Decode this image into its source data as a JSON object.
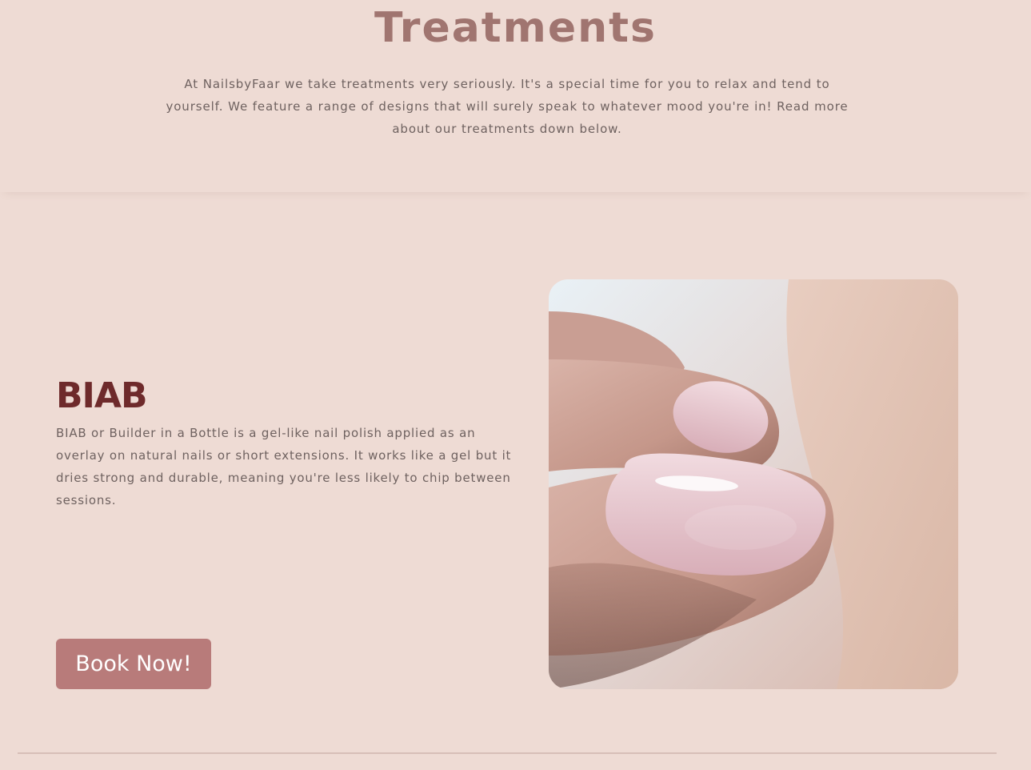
{
  "hero": {
    "title": "Treatments",
    "intro": "At NailsbyFaar we take treatments very seriously. It's a special time for you to relax and tend to yourself. We feature a range of designs that will surely speak to whatever mood you're in! Read more about our treatments down below."
  },
  "treatment": {
    "title": "BIAB",
    "description": "BIAB or Builder in a Bottle is a gel-like nail polish applied as an overlay on natural nails or short extensions. It works like a gel but it dries strong and durable, meaning you're less likely to chip between sessions.",
    "button_label": "Book Now!",
    "image_subject": "close-up of pink glossy BIAB manicured nails"
  },
  "colors": {
    "background": "#eedbd4",
    "title": "#a07570",
    "treatment_title": "#6e2a2b",
    "body_text": "#6f6260",
    "button": "#b87b7a"
  }
}
